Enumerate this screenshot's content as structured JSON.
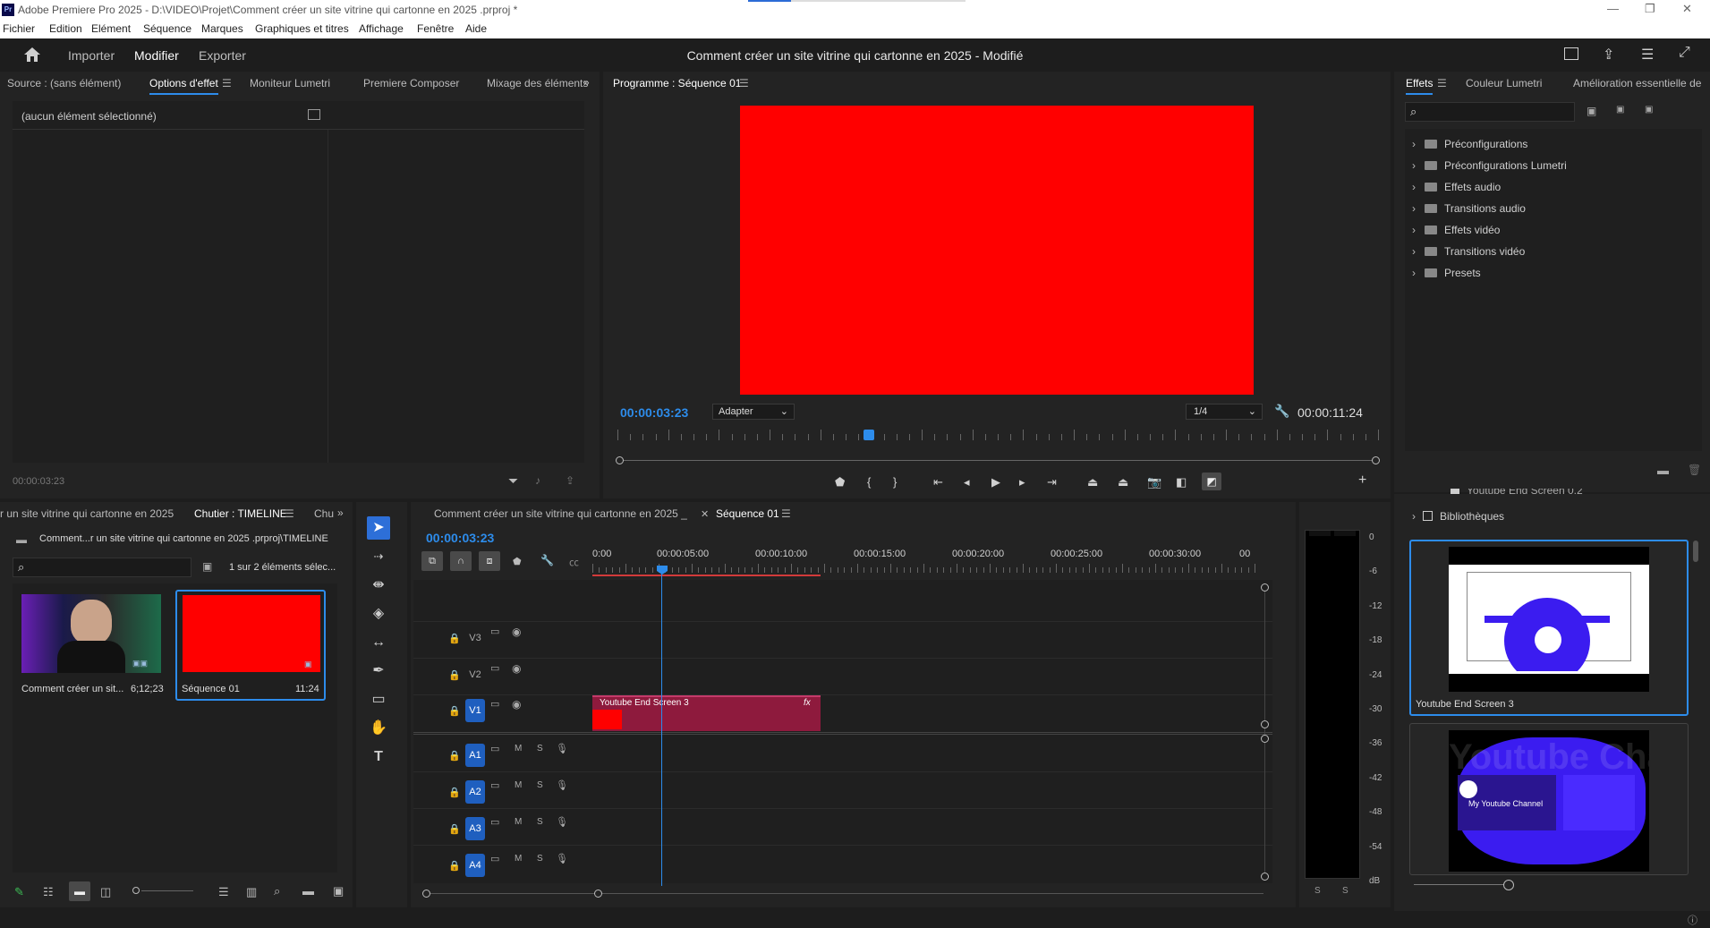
{
  "titlebar": {
    "app_icon": "Pr",
    "title": "Adobe Premiere Pro 2025 - D:\\VIDEO\\Projet\\Comment créer un site vitrine qui cartonne en 2025 .prproj *"
  },
  "menubar": {
    "items": [
      "Fichier",
      "Edition",
      "Elément",
      "Séquence",
      "Marques",
      "Graphiques et titres",
      "Affichage",
      "Fenêtre",
      "Aide"
    ]
  },
  "header": {
    "workspaces": [
      "Importer",
      "Modifier",
      "Exporter"
    ],
    "document_title": "Comment créer un site vitrine qui cartonne en 2025 - Modifié"
  },
  "source_panel": {
    "tabs": [
      "Source : (sans élément)",
      "Options d'effet",
      "Moniteur Lumetri",
      "Premiere Composer",
      "Mixage des éléments"
    ],
    "empty_text": "(aucun élément sélectionné)",
    "timecode": "00:00:03:23"
  },
  "program_monitor": {
    "tab": "Programme : Séquence 01",
    "frame_color": "#ff0000",
    "timecode_current": "00:00:03:23",
    "fit_option": "Adapter",
    "resolution_option": "1/4",
    "timecode_duration": "00:00:11:24",
    "playhead_fraction": 0.33
  },
  "effects_panel": {
    "tabs": [
      "Effets",
      "Couleur Lumetri",
      "Amélioration essentielle de"
    ],
    "items": [
      "Préconfigurations",
      "Préconfigurations Lumetri",
      "Effets audio",
      "Transitions audio",
      "Effets vidéo",
      "Transitions vidéo",
      "Presets"
    ]
  },
  "libraries_panel": {
    "partial_item": "Youtube End Screen 0.2",
    "section": "Bibliothèques",
    "items": [
      {
        "name": "Youtube End Screen 3"
      },
      {
        "name": "",
        "text": "My Youtube Channel",
        "watermark": "Youtube Chan"
      }
    ]
  },
  "project_panel": {
    "tabs": [
      "r un site vitrine qui cartonne en 2025",
      "Chutier : TIMELINE",
      "Chu"
    ],
    "path": "Comment...r un site vitrine qui cartonne en 2025 .prproj\\TIMELINE",
    "selection_count": "1 sur 2 éléments sélec...",
    "items": [
      {
        "name": "Comment créer un sit...",
        "duration": "6;12;23",
        "kind": "video"
      },
      {
        "name": "Séquence 01",
        "duration": "11:24",
        "kind": "sequence",
        "color": "#ff0000"
      }
    ]
  },
  "timeline": {
    "tabs": [
      "Comment créer un site vitrine qui cartonne en 2025 _",
      "Séquence 01"
    ],
    "timecode": "00:00:03:23",
    "ruler": [
      "0:00",
      "00:00:05:00",
      "00:00:10:00",
      "00:00:15:00",
      "00:00:20:00",
      "00:00:25:00",
      "00:00:30:00",
      "00"
    ],
    "video_tracks": [
      "V3",
      "V2",
      "V1"
    ],
    "audio_tracks": [
      "A1",
      "A2",
      "A3",
      "A4"
    ],
    "audio_buttons": [
      "M",
      "S"
    ],
    "clip": {
      "name": "Youtube End Screen 3",
      "fx": "fx"
    }
  },
  "audio_meter": {
    "labels": [
      "0",
      "-6",
      "-12",
      "-18",
      "-24",
      "-30",
      "-36",
      "-42",
      "-48",
      "-54",
      "dB"
    ],
    "solo": [
      "S",
      "S"
    ]
  },
  "colors": {
    "accent": "#2d8ceb",
    "clip": "#8e1a3d",
    "video_frame": "#ff0000",
    "panel_bg": "#232323"
  }
}
